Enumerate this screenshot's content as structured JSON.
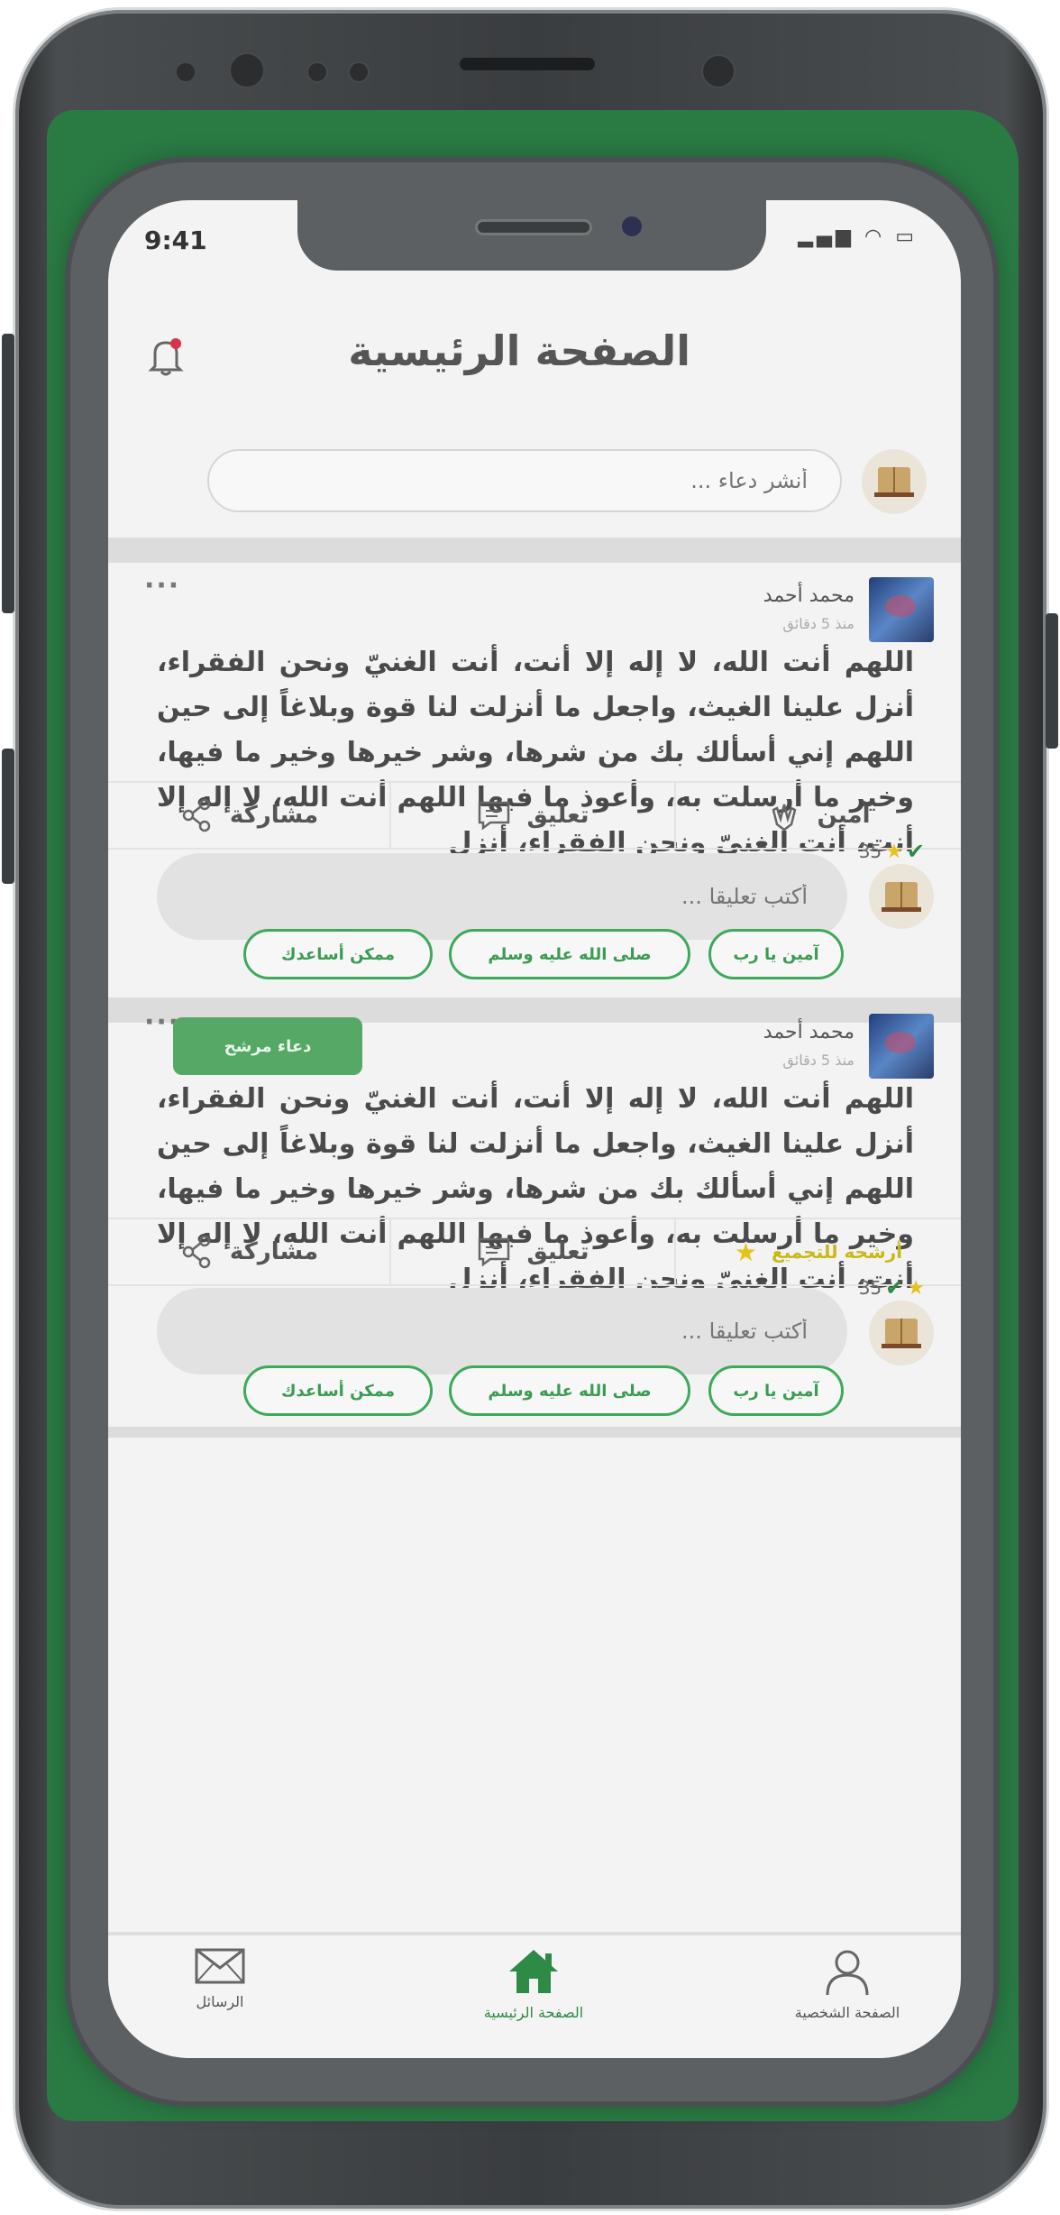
{
  "status": {
    "time": "9:41",
    "icons": "▂▄▆ ◠ ▭"
  },
  "header": {
    "title": "الصفحة الرئيسية"
  },
  "composer": {
    "placeholder": "أنشر دعاء ..."
  },
  "posts": [
    {
      "author": "محمد أحمد",
      "time": "منذ 5 دقائق",
      "text": "اللهم أنت الله، لا إله إلا أنت، أنت الغنيّ ونحن الفقراء، أنزل علينا الغيث، واجعل ما أنزلت لنا قوة وبلاغاً إلى حين  اللهم إني أسألك بك من شرها، وشر خيرها وخير ما فيها، وخير ما أرسلت به، وأعوذ ما فيها اللهم أنت الله، لا إله إلا أنت، أنت الغنيّ ونحن الفقراء، أنزل",
      "actions": {
        "amen": "آمين",
        "comment": "تعليق",
        "share": "مشاركة"
      },
      "count": "35",
      "comment_placeholder": "أكتب تعليقا ...",
      "chips": [
        "آمين يا رب",
        "صلى الله عليه وسلم",
        "ممكن أساعدك"
      ]
    },
    {
      "author": "محمد أحمد",
      "time": "منذ 5 دقائق",
      "badge": "دعاء مرشح",
      "text": "اللهم أنت الله، لا إله إلا أنت، أنت الغنيّ ونحن الفقراء، أنزل علينا الغيث، واجعل ما أنزلت لنا قوة وبلاغاً إلى حين  اللهم إني أسألك بك من شرها، وشر خيرها وخير ما فيها، وخير ما أرسلت به، وأعوذ ما فيها اللهم أنت الله، لا إله إلا أنت، أنت الغنيّ ونحن الفقراء، أنزل",
      "actions": {
        "nominate": "أرشحه للتجميع",
        "comment": "تعليق",
        "share": "مشاركة"
      },
      "count": "35",
      "comment_placeholder": "أكتب تعليقا ...",
      "chips": [
        "آمين يا رب",
        "صلى الله عليه وسلم",
        "ممكن أساعدك"
      ]
    }
  ],
  "nav": {
    "messages": "الرسائل",
    "home": "الصفحة الرئيسية",
    "profile": "الصفحة الشخصية"
  },
  "colors": {
    "brand_green": "#2a7a44",
    "accent_green": "#3ea95a",
    "nominate_yellow": "#c9b81a",
    "screen_bg": "#f3f3f3"
  },
  "icons": {
    "bell": "bell-icon",
    "hands": "praying-hands-icon",
    "comment": "comment-icon",
    "share": "share-icon",
    "star": "star-icon",
    "check": "check-icon",
    "mail": "mail-icon",
    "home": "home-icon",
    "user": "user-icon"
  }
}
